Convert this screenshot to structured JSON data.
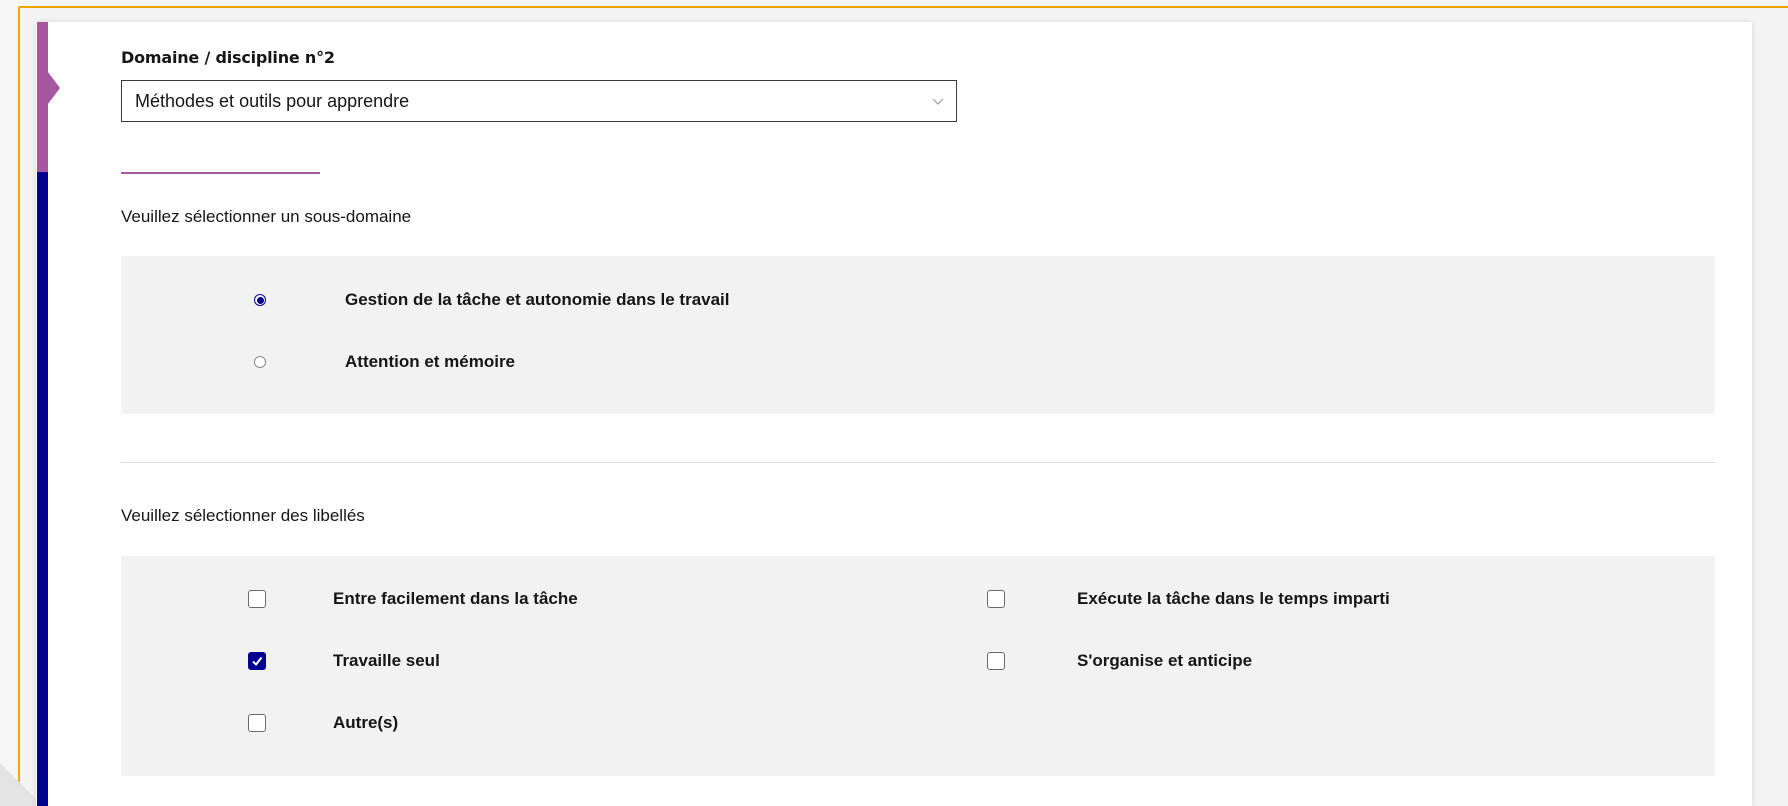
{
  "domain": {
    "label": "Domaine / discipline n°2",
    "selected_value": "Méthodes et outils pour apprendre"
  },
  "subdomain": {
    "title": "Veuillez sélectionner un sous-domaine",
    "options": [
      {
        "label": "Gestion de la tâche et autonomie dans le travail",
        "selected": true
      },
      {
        "label": "Attention et mémoire",
        "selected": false
      }
    ]
  },
  "labels": {
    "title": "Veuillez sélectionner des libellés",
    "items": [
      {
        "label": "Entre facilement dans la tâche",
        "checked": false
      },
      {
        "label": "Exécute la tâche dans le temps imparti",
        "checked": false
      },
      {
        "label": "Travaille seul",
        "checked": true
      },
      {
        "label": "S'organise et anticipe",
        "checked": false
      },
      {
        "label": "Autre(s)",
        "checked": false
      }
    ]
  },
  "colors": {
    "accent_blue": "#000091",
    "accent_purple": "#a558a0",
    "frame_orange": "#f0a800"
  }
}
